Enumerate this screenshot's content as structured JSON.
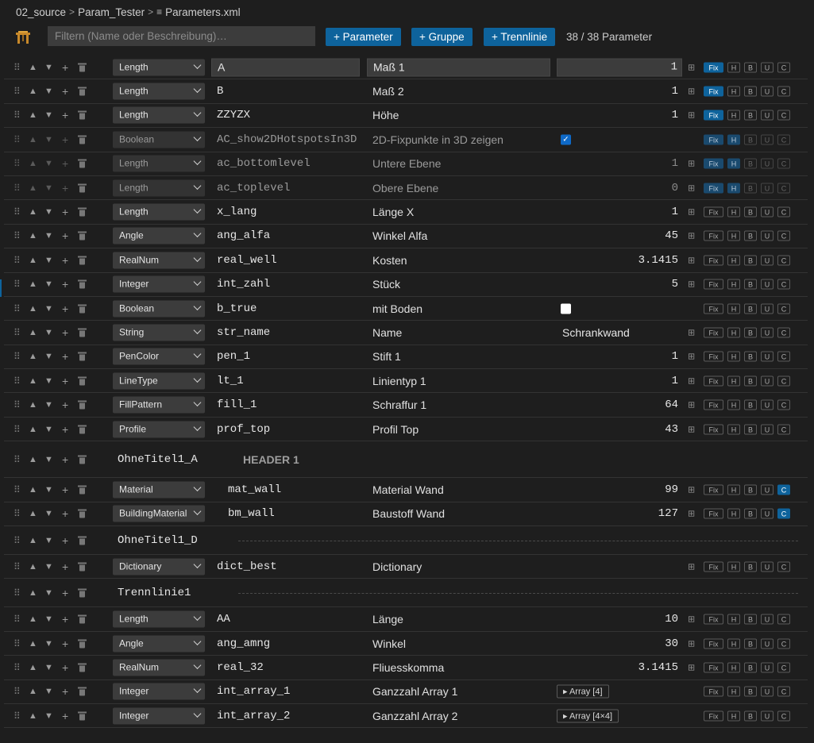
{
  "breadcrumb": {
    "part1": "02_source",
    "part2": "Param_Tester",
    "file": "Parameters.xml"
  },
  "toolbar": {
    "search_placeholder": "Filtern (Name oder Beschreibung)…",
    "add_parameter": "+ Parameter",
    "add_group": "+ Gruppe",
    "add_separator": "+ Trennlinie",
    "count": "38 / 38 Parameter"
  },
  "icons": {
    "grip": "drag-handle-icon",
    "up": "arrow-up-icon",
    "down": "arrow-down-icon",
    "add": "plus-icon",
    "delete": "trash-icon",
    "grid": "grid-icon",
    "check": "checkmark-icon"
  },
  "colors": {
    "accent": "#0e639c",
    "background": "#1e1e1e",
    "input": "#3c3c3c"
  },
  "flag_labels": {
    "fix": "Fix",
    "h": "H",
    "b": "B",
    "u": "U",
    "c": "C"
  },
  "rows": [
    {
      "kind": "param",
      "type": "Length",
      "name": "A",
      "desc": "Maß 1",
      "value": "1",
      "editing": true,
      "flags": {
        "fix": true,
        "h": false,
        "c": false
      }
    },
    {
      "kind": "param",
      "type": "Length",
      "name": "B",
      "desc": "Maß 2",
      "value": "1",
      "flags": {
        "fix": true,
        "h": false,
        "c": false
      }
    },
    {
      "kind": "param",
      "type": "Length",
      "name": "ZZYZX",
      "desc": "Höhe",
      "value": "1",
      "flags": {
        "fix": true,
        "h": false,
        "c": false
      }
    },
    {
      "kind": "param",
      "type": "Boolean",
      "name": "AC_show2DHotspotsIn3D",
      "desc": "2D-Fixpunkte in 3D zeigen",
      "checkbox": true,
      "disabled": true,
      "flags": {
        "fix": true,
        "h": true,
        "c": false
      }
    },
    {
      "kind": "param",
      "type": "Length",
      "name": "ac_bottomlevel",
      "desc": "Untere Ebene",
      "value": "1",
      "disabled": true,
      "flags": {
        "fix": true,
        "h": true,
        "c": false
      }
    },
    {
      "kind": "param",
      "type": "Length",
      "name": "ac_toplevel",
      "desc": "Obere Ebene",
      "value": "0",
      "disabled": true,
      "flags": {
        "fix": true,
        "h": true,
        "c": false
      }
    },
    {
      "kind": "param",
      "type": "Length",
      "name": "x_lang",
      "desc": "Länge X",
      "value": "1",
      "flags": {
        "fix": false,
        "h": false,
        "c": false
      }
    },
    {
      "kind": "param",
      "type": "Angle",
      "name": "ang_alfa",
      "desc": "Winkel Alfa",
      "value": "45",
      "flags": {
        "fix": false,
        "h": false,
        "c": false
      }
    },
    {
      "kind": "param",
      "type": "RealNum",
      "name": "real_well",
      "desc": "Kosten",
      "value": "3.1415",
      "flags": {
        "fix": false,
        "h": false,
        "c": false
      }
    },
    {
      "kind": "param",
      "type": "Integer",
      "name": "int_zahl",
      "desc": "Stück",
      "value": "5",
      "flags": {
        "fix": false,
        "h": false,
        "c": false
      }
    },
    {
      "kind": "param",
      "type": "Boolean",
      "name": "b_true",
      "desc": "mit Boden",
      "checkbox": false,
      "flags": {
        "fix": false,
        "h": false,
        "c": false
      }
    },
    {
      "kind": "param",
      "type": "String",
      "name": "str_name",
      "desc": "Name",
      "string_value": "Schrankwand",
      "flags": {
        "fix": false,
        "h": false,
        "c": false
      }
    },
    {
      "kind": "param",
      "type": "PenColor",
      "name": "pen_1",
      "desc": "Stift 1",
      "value": "1",
      "flags": {
        "fix": false,
        "h": false,
        "c": false
      }
    },
    {
      "kind": "param",
      "type": "LineType",
      "name": "lt_1",
      "desc": "Linientyp 1",
      "value": "1",
      "flags": {
        "fix": false,
        "h": false,
        "c": false
      }
    },
    {
      "kind": "param",
      "type": "FillPattern",
      "name": "fill_1",
      "desc": "Schraffur 1",
      "value": "64",
      "flags": {
        "fix": false,
        "h": false,
        "c": false
      }
    },
    {
      "kind": "param",
      "type": "Profile",
      "name": "prof_top",
      "desc": "Profil Top",
      "value": "43",
      "flags": {
        "fix": false,
        "h": false,
        "c": false
      }
    },
    {
      "kind": "group",
      "name": "OhneTitel1_A",
      "header": "HEADER 1"
    },
    {
      "kind": "param",
      "type": "Material",
      "name": "mat_wall",
      "desc": "Material Wand",
      "value": "99",
      "indent": true,
      "flags": {
        "fix": false,
        "h": false,
        "c": true
      }
    },
    {
      "kind": "param",
      "type": "BuildingMaterial",
      "name": "bm_wall",
      "desc": "Baustoff Wand",
      "value": "127",
      "indent": true,
      "flags": {
        "fix": false,
        "h": false,
        "c": true
      }
    },
    {
      "kind": "separator",
      "name": "OhneTitel1_D"
    },
    {
      "kind": "param",
      "type": "Dictionary",
      "name": "dict_best",
      "desc": "Dictionary",
      "flags": {
        "fix": false,
        "h": false,
        "c": false
      }
    },
    {
      "kind": "separator",
      "name": "Trennlinie1"
    },
    {
      "kind": "param",
      "type": "Length",
      "name": "AA",
      "desc": "Länge",
      "value": "10",
      "flags": {
        "fix": false,
        "h": false,
        "c": false
      }
    },
    {
      "kind": "param",
      "type": "Angle",
      "name": "ang_amng",
      "desc": "Winkel",
      "value": "30",
      "flags": {
        "fix": false,
        "h": false,
        "c": false
      }
    },
    {
      "kind": "param",
      "type": "RealNum",
      "name": "real_32",
      "desc": "Fliuesskomma",
      "value": "3.1415",
      "flags": {
        "fix": false,
        "h": false,
        "c": false
      }
    },
    {
      "kind": "param",
      "type": "Integer",
      "name": "int_array_1",
      "desc": "Ganzzahl Array 1",
      "array": "▸ Array [4]",
      "flags": {
        "fix": false,
        "h": false,
        "c": false
      }
    },
    {
      "kind": "param",
      "type": "Integer",
      "name": "int_array_2",
      "desc": "Ganzzahl Array 2",
      "array": "▸ Array [4×4]",
      "flags": {
        "fix": false,
        "h": false,
        "c": false
      }
    }
  ]
}
